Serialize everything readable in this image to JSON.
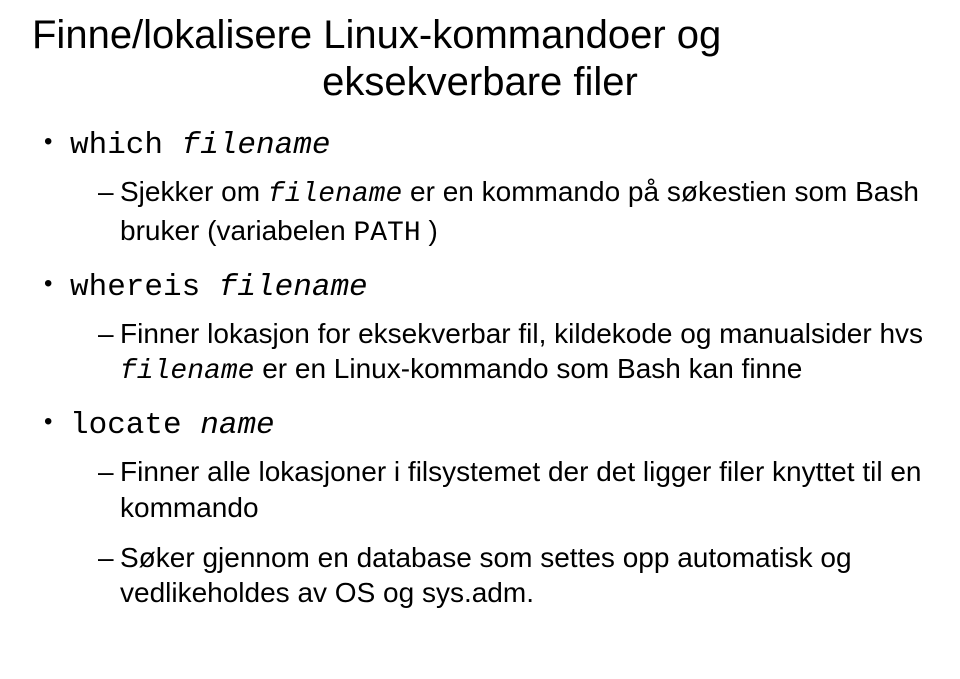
{
  "title": {
    "line1": "Finne/lokalisere Linux-kommandoer og",
    "line2": "eksekverbare filer"
  },
  "bullets": [
    {
      "cmd": "which ",
      "arg": "filename",
      "subs": [
        {
          "pre": "Sjekker om ",
          "code": "filename",
          "post_a": " er en kommando på søkestien som Bash bruker (variabelen ",
          "code2": "PATH",
          "post_b": " )"
        }
      ]
    },
    {
      "cmd": "whereis ",
      "arg": "filename",
      "subs": [
        {
          "pre": "Finner lokasjon for eksekverbar fil, kildekode og manualsider hvs ",
          "code": "filename",
          "post_a": " er en Linux-kommando som Bash kan finne",
          "code2": "",
          "post_b": ""
        }
      ]
    },
    {
      "cmd": "locate ",
      "arg": "name",
      "subs": [
        {
          "pre": "Finner alle lokasjoner i filsystemet der det ligger filer knyttet til en kommando",
          "code": "",
          "post_a": "",
          "code2": "",
          "post_b": ""
        },
        {
          "pre": "Søker gjennom en database som settes opp automatisk og vedlikeholdes av OS og sys.adm.",
          "code": "",
          "post_a": "",
          "code2": "",
          "post_b": ""
        }
      ]
    }
  ]
}
